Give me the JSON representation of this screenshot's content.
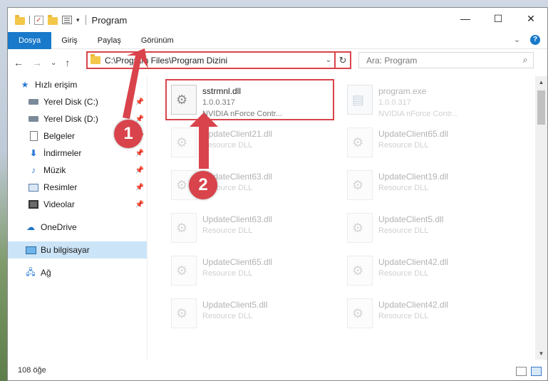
{
  "window": {
    "title": "Program",
    "controls": {
      "minimize": "—",
      "maximize": "☐",
      "close": "✕"
    }
  },
  "ribbon": {
    "tabs": [
      "Dosya",
      "Giriş",
      "Paylaş",
      "Görünüm"
    ],
    "expand_glyph": "⌄",
    "help_glyph": "?"
  },
  "nav": {
    "back": "←",
    "forward": "→",
    "recent": "⌄",
    "up": "↑"
  },
  "address": {
    "path": "C:\\Program Files\\Program Dizini",
    "dropdown": "⌄",
    "refresh": "↻"
  },
  "search": {
    "placeholder": "Ara: Program",
    "icon": "⌕"
  },
  "sidebar": {
    "items": [
      {
        "label": "Hızlı erişim",
        "icon": "star-icon"
      },
      {
        "label": "Yerel Disk (C:)",
        "icon": "disk-icon",
        "pinned": true
      },
      {
        "label": "Yerel Disk (D:)",
        "icon": "disk-icon",
        "pinned": true
      },
      {
        "label": "Belgeler",
        "icon": "document-icon",
        "pinned": true
      },
      {
        "label": "İndirmeler",
        "icon": "download-icon",
        "pinned": true
      },
      {
        "label": "Müzik",
        "icon": "music-icon",
        "pinned": true
      },
      {
        "label": "Resimler",
        "icon": "pictures-icon",
        "pinned": true
      },
      {
        "label": "Videolar",
        "icon": "videos-icon",
        "pinned": true
      },
      {
        "label": "OneDrive",
        "icon": "cloud-icon"
      },
      {
        "label": "Bu bilgisayar",
        "icon": "computer-icon",
        "selected": true
      },
      {
        "label": "Ağ",
        "icon": "network-icon"
      }
    ]
  },
  "files": [
    {
      "name": "sstrmnl.dll",
      "line2": "1.0.0.317",
      "line3": "NVIDIA nForce Contr...",
      "highlighted": true
    },
    {
      "name": "program.exe",
      "line2": "1.0.0.317",
      "line3": "NVIDIA nForce Contr...",
      "faded": true
    },
    {
      "name": "UpdateClient21.dll",
      "line2": "Resource DLL",
      "faded": true
    },
    {
      "name": "UpdateClient65.dll",
      "line2": "Resource DLL",
      "faded": true
    },
    {
      "name": "UpdateClient63.dll",
      "line2": "Resource DLL",
      "faded": true
    },
    {
      "name": "UpdateClient19.dll",
      "line2": "Resource DLL",
      "faded": true
    },
    {
      "name": "UpdateClient63.dll",
      "line2": "Resource DLL",
      "faded": true
    },
    {
      "name": "UpdateClient5.dll",
      "line2": "Resource DLL",
      "faded": true
    },
    {
      "name": "UpdateClient65.dll",
      "line2": "Resource DLL",
      "faded": true
    },
    {
      "name": "UpdateClient42.dll",
      "line2": "Resource DLL",
      "faded": true
    },
    {
      "name": "UpdateClient5.dll",
      "line2": "Resource DLL",
      "faded": true
    },
    {
      "name": "UpdateClient42.dll",
      "line2": "Resource DLL",
      "faded": true
    }
  ],
  "status": {
    "count": "108 öğe"
  },
  "callouts": [
    "1",
    "2"
  ],
  "colors": {
    "accent": "#1979ca",
    "highlight": "#d9434b",
    "selected": "#cce4f7"
  }
}
